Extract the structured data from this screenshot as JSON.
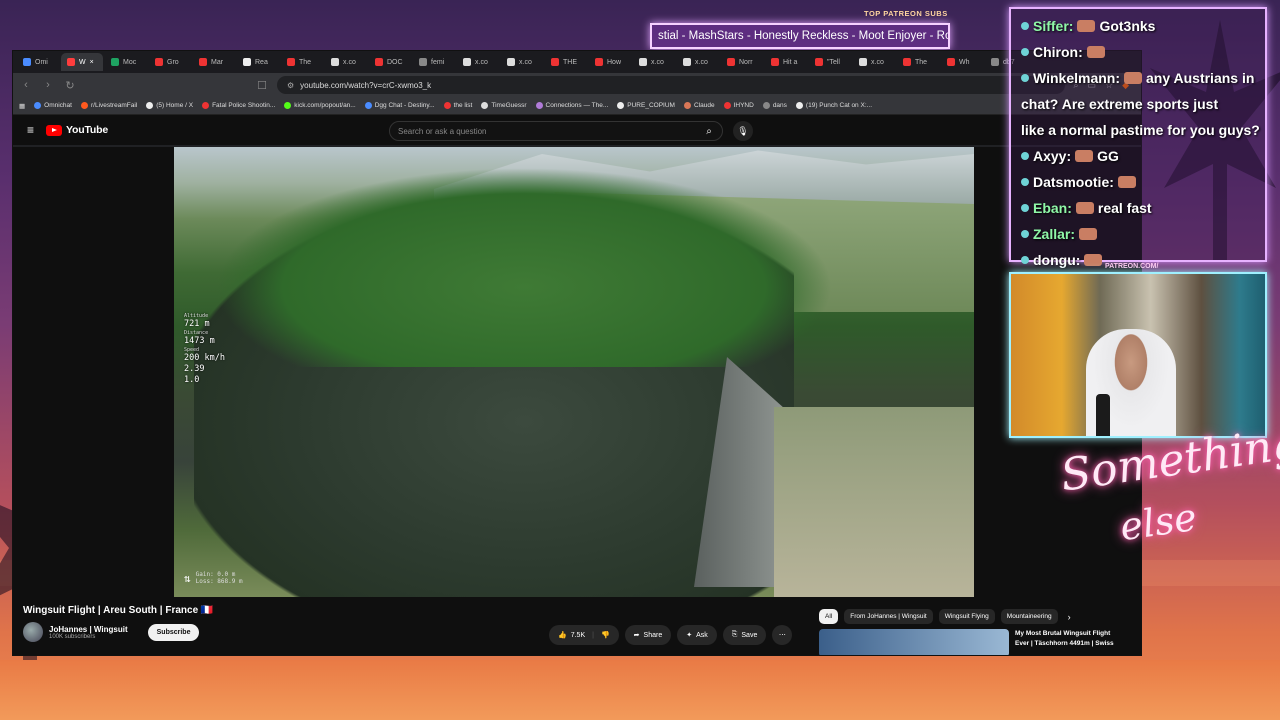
{
  "browser": {
    "tabs": [
      {
        "label": "Omi",
        "color": "#4a8cff"
      },
      {
        "label": "W",
        "color": "#ff3d3d",
        "active": true
      },
      {
        "label": "Moc",
        "color": "#1ea362"
      },
      {
        "label": "Gro",
        "color": "#e33"
      },
      {
        "label": "Mar",
        "color": "#e33"
      },
      {
        "label": "Rea",
        "color": "#eee"
      },
      {
        "label": "The",
        "color": "#e33"
      },
      {
        "label": "x.co",
        "color": "#ddd"
      },
      {
        "label": "DOC",
        "color": "#e33"
      },
      {
        "label": "femi",
        "color": "#888"
      },
      {
        "label": "x.co",
        "color": "#ddd"
      },
      {
        "label": "x.co",
        "color": "#ddd"
      },
      {
        "label": "THE",
        "color": "#e33"
      },
      {
        "label": "How",
        "color": "#e33"
      },
      {
        "label": "x.co",
        "color": "#ddd"
      },
      {
        "label": "x.co",
        "color": "#ddd"
      },
      {
        "label": "Norr",
        "color": "#e33"
      },
      {
        "label": "Hit a",
        "color": "#e33"
      },
      {
        "label": "\"Tell",
        "color": "#e33"
      },
      {
        "label": "x.co",
        "color": "#ddd"
      },
      {
        "label": "The",
        "color": "#e33"
      },
      {
        "label": "Wh",
        "color": "#e33"
      },
      {
        "label": "db7",
        "color": "#888"
      }
    ],
    "url": "youtube.com/watch?v=crC-xwmo3_k",
    "bookmarks": [
      {
        "label": "Omnichat",
        "color": "#4a8cff"
      },
      {
        "label": "r/LivestreamFail",
        "color": "#ff5a1f"
      },
      {
        "label": "(5) Home / X",
        "color": "#eee"
      },
      {
        "label": "Fatal Police Shootin...",
        "color": "#e33"
      },
      {
        "label": "kick.com/popout/an...",
        "color": "#53fc18"
      },
      {
        "label": "Dgg Chat - Destiny...",
        "color": "#4a8cff"
      },
      {
        "label": "the list",
        "color": "#e33"
      },
      {
        "label": "TimeGuessr",
        "color": "#ddd"
      },
      {
        "label": "Connections — The...",
        "color": "#b07bd8"
      },
      {
        "label": "PURE_COPIUM",
        "color": "#eee"
      },
      {
        "label": "Claude",
        "color": "#d97757"
      },
      {
        "label": "IHYND",
        "color": "#e33"
      },
      {
        "label": "dans",
        "color": "#888"
      },
      {
        "label": "(19) Punch Cat on X:...",
        "color": "#eee"
      }
    ]
  },
  "youtube": {
    "logo": "YouTube",
    "search_placeholder": "Search or ask a question",
    "telemetry": [
      {
        "label": "Altitude",
        "value": "721 m"
      },
      {
        "label": "Distance",
        "value": "1473 m"
      },
      {
        "label": "Speed",
        "value": "200 km/h"
      },
      {
        "label": "",
        "value": "2.39"
      },
      {
        "label": "",
        "value": "1.0"
      }
    ],
    "gain": "Gain: 0.0 m",
    "loss": "Loss: 868.9 m",
    "video_title": "Wingsuit Flight | Areu South | France 🇫🇷",
    "channel_name": "JoHannes | Wingsuit",
    "channel_subs": "100K subscribers",
    "subscribe_label": "Subscribe",
    "like_count": "7.5K",
    "share_label": "Share",
    "ask_label": "Ask",
    "save_label": "Save",
    "chips": [
      "All",
      "From JoHannes | Wingsuit",
      "Wingsuit Flying",
      "Mountaineering"
    ],
    "rec_title": "My Most Brutal Wingsuit Flight Ever | Täschhorn 4491m | Swiss"
  },
  "overlay": {
    "patreon_header": "TOP PATREON SUBS",
    "ticker": "stial - MashStars - Honestly Reckless - Moot Enjoyer - Roa",
    "patreon_url": "PATREON.COM/",
    "neon_line1": "Something",
    "neon_line2": "else",
    "chat": [
      {
        "user": "Siffer:",
        "text": "Got3nks",
        "color": "#8ff7a7"
      },
      {
        "user": "Chiron:",
        "text": "",
        "color": "#ffffff"
      },
      {
        "user": "Winkelmann:",
        "text": "any Austrians in",
        "color": "#ffffff"
      },
      {
        "user": "",
        "text": "chat? Are extreme sports just",
        "color": "#ffffff"
      },
      {
        "user": "",
        "text": "like a normal pastime for you guys?",
        "color": "#ffffff"
      },
      {
        "user": "Axyy:",
        "text": "GG",
        "color": "#ffffff"
      },
      {
        "user": "Datsmootie:",
        "text": "",
        "color": "#ffffff"
      },
      {
        "user": "Eban:",
        "text": "real fast",
        "color": "#8ff7a7"
      },
      {
        "user": "Zallar:",
        "text": "",
        "color": "#8ff7a7"
      },
      {
        "user": "dongu:",
        "text": "",
        "color": "#ffffff"
      }
    ]
  }
}
